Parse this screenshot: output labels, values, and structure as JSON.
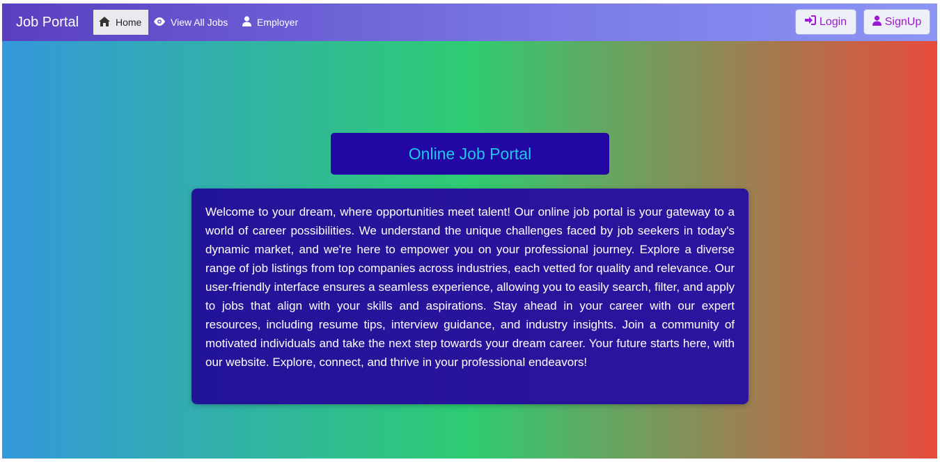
{
  "navbar": {
    "brand": "Job Portal",
    "links": [
      {
        "label": "Home",
        "icon": "home-icon",
        "active": true
      },
      {
        "label": "View All Jobs",
        "icon": "eye-icon",
        "active": false
      },
      {
        "label": "Employer",
        "icon": "user-icon",
        "active": false
      }
    ],
    "login_label": "Login",
    "signup_label": "SignUp"
  },
  "hero": {
    "title": "Online Job Portal",
    "description": "Welcome to your dream, where opportunities meet talent! Our online job portal is your gateway to a world of career possibilities. We understand the unique challenges faced by job seekers in today's dynamic market, and we're here to empower you on your professional journey. Explore a diverse range of job listings from top companies across industries, each vetted for quality and relevance. Our user-friendly interface ensures a seamless experience, allowing you to easily search, filter, and apply to jobs that align with your skills and aspirations. Stay ahead in your career with our expert resources, including resume tips, interview guidance, and industry insights. Join a community of motivated individuals and take the next step towards your dream career. Your future starts here, with our website. Explore, connect, and thrive in your professional endeavors!"
  },
  "colors": {
    "navbar_start": "#5a3fc0",
    "navbar_end": "#8c95f5",
    "title_box": "#2307a3",
    "title_text": "#1ec8e8",
    "button_text": "#9b18d6",
    "gradient_left": "#3498db",
    "gradient_mid": "#2ecc71",
    "gradient_right": "#e74c3c"
  }
}
